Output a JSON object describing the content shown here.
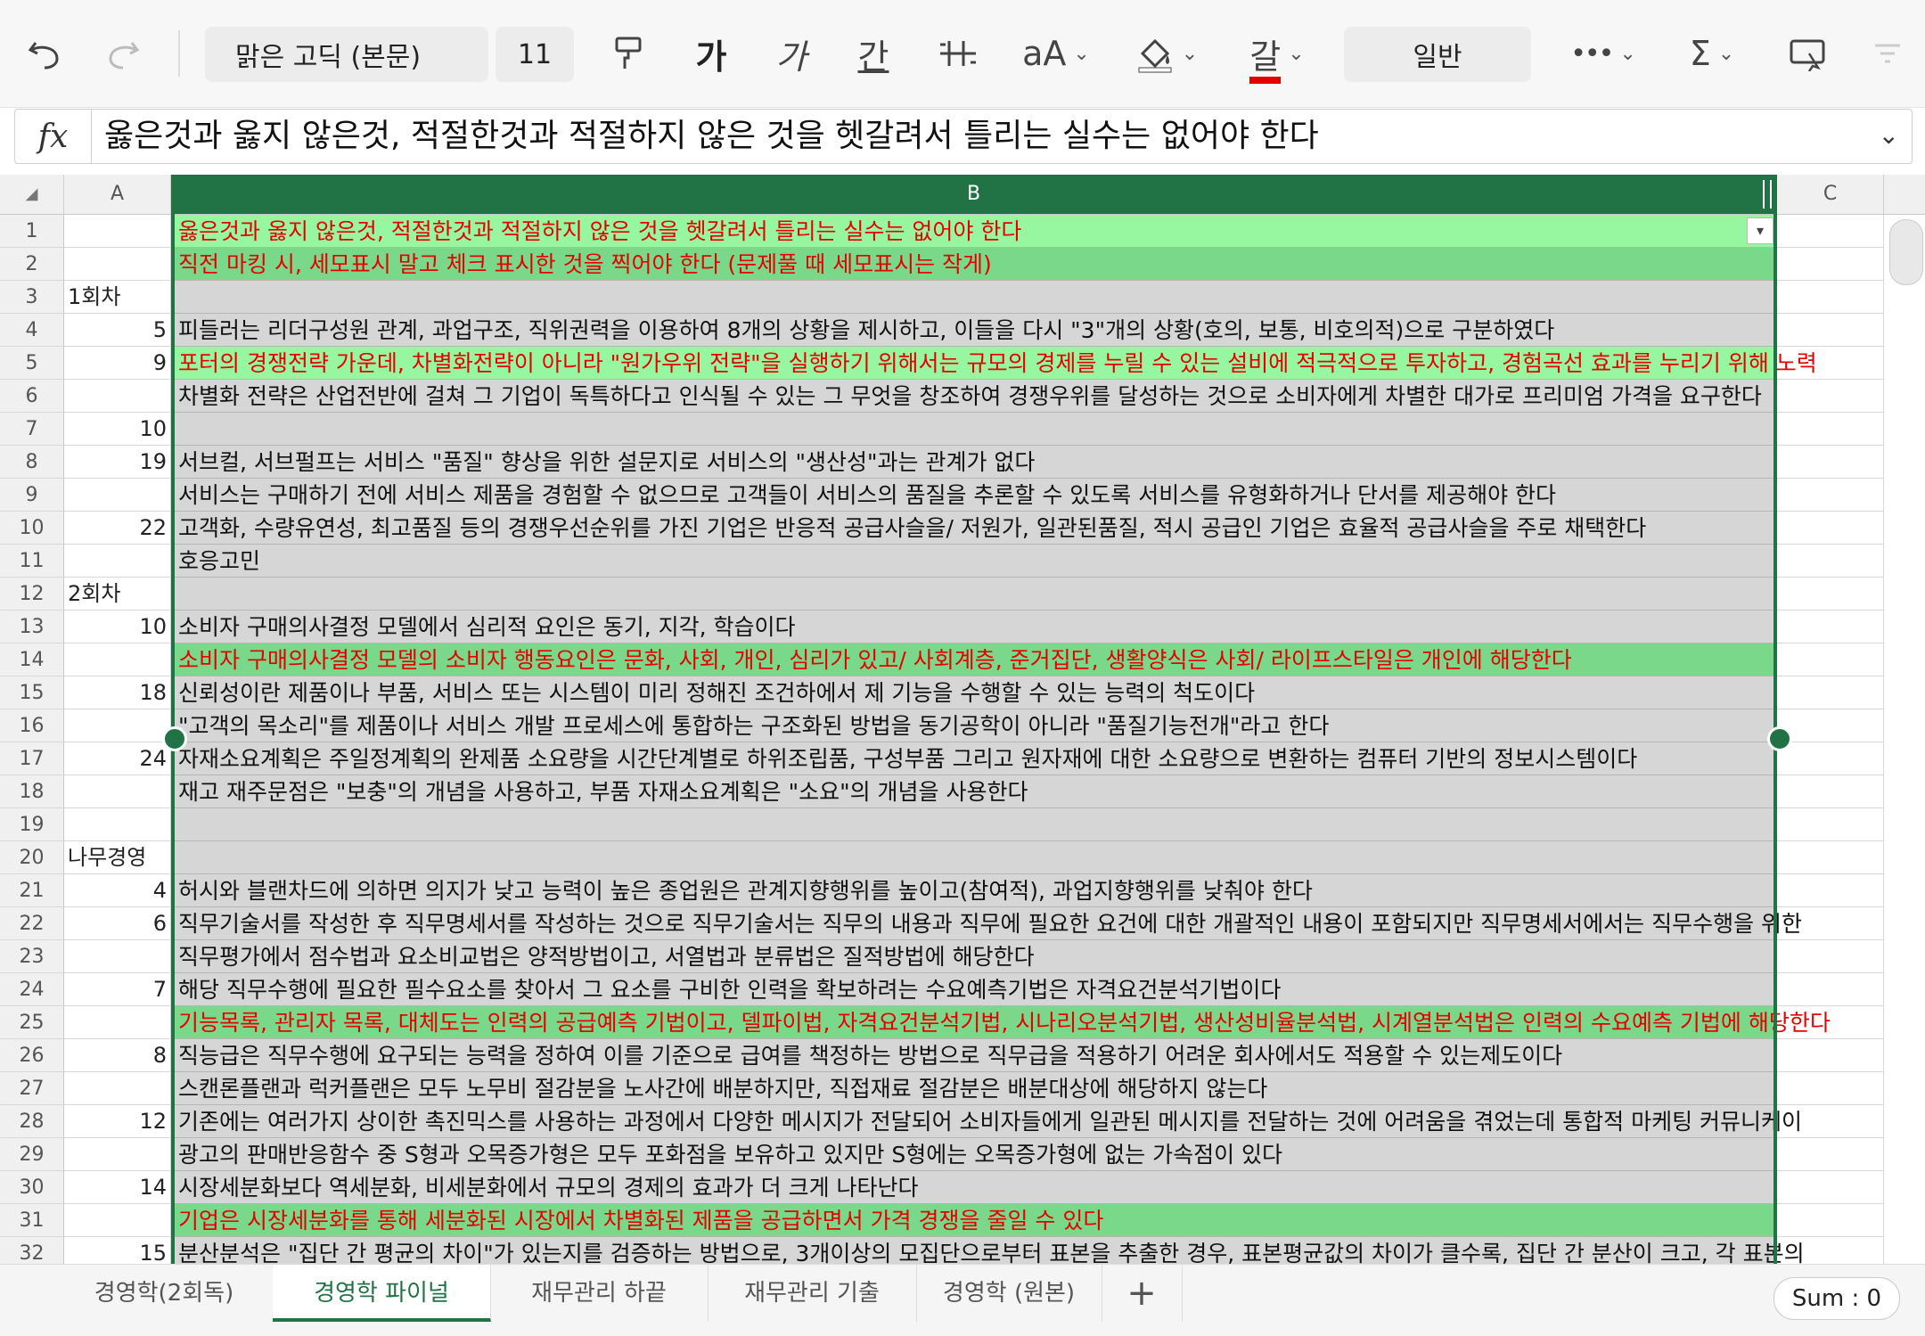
{
  "toolbar": {
    "font_name": "맑은 고딕 (본문)",
    "font_size": "11",
    "bold_label": "가",
    "italic_label": "가",
    "underline_label": "간",
    "font_grow_label": "aA",
    "font_color_label": "갈",
    "number_format": "일반",
    "colors": {
      "font_color_bar": "#e00000",
      "accent": "#217346"
    }
  },
  "formula_bar": {
    "fx_label": "fx",
    "value": "옳은것과 옳지 않은것, 적절한것과 적절하지 않은 것을 헷갈려서 틀리는 실수는 없어야 한다"
  },
  "columns": {
    "corner": "◢",
    "a": "A",
    "b": "B",
    "c": "C"
  },
  "rows": [
    {
      "n": "1",
      "a": "",
      "b": "옳은것과 옳지 않은것, 적절한것과 적절하지 않은 것을 헷갈려서 틀리는 실수는 없어야 한다",
      "fill": "g1",
      "red": true
    },
    {
      "n": "2",
      "a": "",
      "b": "직전 마킹 시, 세모표시 말고 체크 표시한 것을 찍어야 한다 (문제풀 때 세모표시는 작게)",
      "fill": "g2",
      "red": true
    },
    {
      "n": "3",
      "a": "1회차",
      "b": "",
      "fill": "",
      "red": false
    },
    {
      "n": "4",
      "a": "5",
      "b": "피들러는 리더구성원 관계, 과업구조, 직위권력을 이용하여 8개의 상황을 제시하고, 이들을 다시 \"3\"개의 상황(호의, 보통, 비호의적)으로 구분하였다",
      "fill": "",
      "red": false
    },
    {
      "n": "5",
      "a": "9",
      "b": "포터의 경쟁전략 가운데, 차별화전략이 아니라 \"원가우위 전략\"을 실행하기 위해서는 규모의 경제를 누릴 수 있는 설비에 적극적으로 투자하고, 경험곡선 효과를 누리기 위해 노력",
      "fill": "g1",
      "red": true
    },
    {
      "n": "6",
      "a": "",
      "b": "차별화 전략은 산업전반에 걸쳐 그 기업이 독특하다고 인식될 수 있는 그 무엇을 창조하여 경쟁우위를 달성하는 것으로 소비자에게 차별한 대가로 프리미엄 가격을 요구한다",
      "fill": "",
      "red": false
    },
    {
      "n": "7",
      "a": "10",
      "b": "",
      "fill": "",
      "red": false
    },
    {
      "n": "8",
      "a": "19",
      "b": "서브컬, 서브펄프는 서비스 \"품질\" 향상을 위한 설문지로 서비스의 \"생산성\"과는 관계가 없다",
      "fill": "",
      "red": false
    },
    {
      "n": "9",
      "a": "",
      "b": "서비스는 구매하기 전에 서비스 제품을 경험할 수 없으므로 고객들이 서비스의 품질을 추론할 수 있도록 서비스를 유형화하거나 단서를 제공해야 한다",
      "fill": "",
      "red": false
    },
    {
      "n": "10",
      "a": "22",
      "b": "고객화, 수량유연성, 최고품질 등의 경쟁우선순위를 가진 기업은 반응적 공급사슬을/ 저원가, 일관된품질, 적시 공급인 기업은 효율적 공급사슬을 주로 채택한다",
      "fill": "",
      "red": false
    },
    {
      "n": "11",
      "a": "",
      "b": "호응고민",
      "fill": "",
      "red": false
    },
    {
      "n": "12",
      "a": "2회차",
      "b": "",
      "fill": "",
      "red": false
    },
    {
      "n": "13",
      "a": "10",
      "b": "소비자 구매의사결정 모델에서 심리적 요인은 동기, 지각, 학습이다",
      "fill": "",
      "red": false
    },
    {
      "n": "14",
      "a": "",
      "b": "소비자 구매의사결정 모델의 소비자 행동요인은 문화, 사회, 개인, 심리가 있고/ 사회계층, 준거집단, 생활양식은 사회/ 라이프스타일은 개인에 해당한다",
      "fill": "g2",
      "red": true
    },
    {
      "n": "15",
      "a": "18",
      "b": "신뢰성이란 제품이나 부품, 서비스 또는 시스템이 미리 정해진 조건하에서 제 기능을 수행할 수 있는 능력의 척도이다",
      "fill": "",
      "red": false
    },
    {
      "n": "16",
      "a": "",
      "b": "\"고객의 목소리\"를 제품이나 서비스 개발 프로세스에 통합하는 구조화된 방법을 동기공학이 아니라 \"품질기능전개\"라고 한다",
      "fill": "",
      "red": false
    },
    {
      "n": "17",
      "a": "24",
      "b": "자재소요계획은 주일정계획의 완제품 소요량을 시간단계별로 하위조립품, 구성부품 그리고 원자재에 대한 소요량으로 변환하는 컴퓨터 기반의 정보시스템이다",
      "fill": "",
      "red": false
    },
    {
      "n": "18",
      "a": "",
      "b": "재고 재주문점은 \"보충\"의 개념을 사용하고, 부품 자재소요계획은 \"소요\"의 개념을 사용한다",
      "fill": "",
      "red": false
    },
    {
      "n": "19",
      "a": "",
      "b": "",
      "fill": "",
      "red": false
    },
    {
      "n": "20",
      "a": "나무경영",
      "b": "",
      "fill": "",
      "red": false
    },
    {
      "n": "21",
      "a": "4",
      "b": "허시와 블랜차드에 의하면 의지가 낮고 능력이 높은 종업원은 관계지향행위를 높이고(참여적), 과업지향행위를 낮춰야 한다",
      "fill": "",
      "red": false
    },
    {
      "n": "22",
      "a": "6",
      "b": "직무기술서를 작성한 후 직무명세서를 작성하는 것으로 직무기술서는 직무의 내용과 직무에 필요한 요건에 대한 개괄적인 내용이 포함되지만 직무명세서에서는 직무수행을 위한",
      "fill": "",
      "red": false
    },
    {
      "n": "23",
      "a": "",
      "b": "직무평가에서 점수법과 요소비교법은 양적방법이고, 서열법과 분류법은 질적방법에 해당한다",
      "fill": "",
      "red": false
    },
    {
      "n": "24",
      "a": "7",
      "b": "해당 직무수행에 필요한 필수요소를 찾아서 그 요소를 구비한 인력을 확보하려는 수요예측기법은 자격요건분석기법이다",
      "fill": "",
      "red": false
    },
    {
      "n": "25",
      "a": "",
      "b": "기능목록, 관리자 목록, 대체도는 인력의 공급예측 기법이고, 델파이법, 자격요건분석기법, 시나리오분석기법, 생산성비율분석법, 시계열분석법은 인력의 수요예측 기법에 해당한다",
      "fill": "g2",
      "red": true
    },
    {
      "n": "26",
      "a": "8",
      "b": "직능급은 직무수행에 요구되는 능력을 정하여 이를 기준으로 급여를 책정하는 방법으로 직무급을 적용하기 어려운 회사에서도 적용할 수 있는제도이다",
      "fill": "",
      "red": false
    },
    {
      "n": "27",
      "a": "",
      "b": "스캔론플랜과 럭커플랜은 모두 노무비 절감분을 노사간에 배분하지만, 직접재료 절감분은 배분대상에 해당하지 않는다",
      "fill": "",
      "red": false
    },
    {
      "n": "28",
      "a": "12",
      "b": "기존에는 여러가지 상이한 촉진믹스를 사용하는 과정에서 다양한 메시지가 전달되어 소비자들에게 일관된 메시지를 전달하는 것에 어려움을 겪었는데 통합적 마케팅 커뮤니케이",
      "fill": "",
      "red": false
    },
    {
      "n": "29",
      "a": "",
      "b": "광고의 판매반응함수 중 S형과 오목증가형은 모두 포화점을 보유하고 있지만 S형에는 오목증가형에 없는 가속점이 있다",
      "fill": "",
      "red": false
    },
    {
      "n": "30",
      "a": "14",
      "b": "시장세분화보다 역세분화, 비세분화에서 규모의 경제의 효과가 더 크게 나타난다",
      "fill": "",
      "red": false
    },
    {
      "n": "31",
      "a": "",
      "b": "기업은 시장세분화를 통해 세분화된 시장에서 차별화된 제품을 공급하면서 가격 경쟁을 줄일 수 있다",
      "fill": "g2",
      "red": true
    },
    {
      "n": "32",
      "a": "15",
      "b": "분산분석은 \"집단 간 평균의 차이\"가 있는지를 검증하는 방법으로, 3개이상의 모집단으로부터 표본을 추출한 경우, 표본평균값의 차이가 클수록, 집단 간 분산이 크고, 각 표본의",
      "fill": "",
      "red": false
    }
  ],
  "tabs": [
    "경영학(2회독)",
    "경영학 파이널",
    "재무관리 하끝",
    "재무관리 기출",
    "경영학 (원본)"
  ],
  "active_tab": "경영학 파이널",
  "add_sheet": "+",
  "status": {
    "sum": "Sum : 0"
  }
}
